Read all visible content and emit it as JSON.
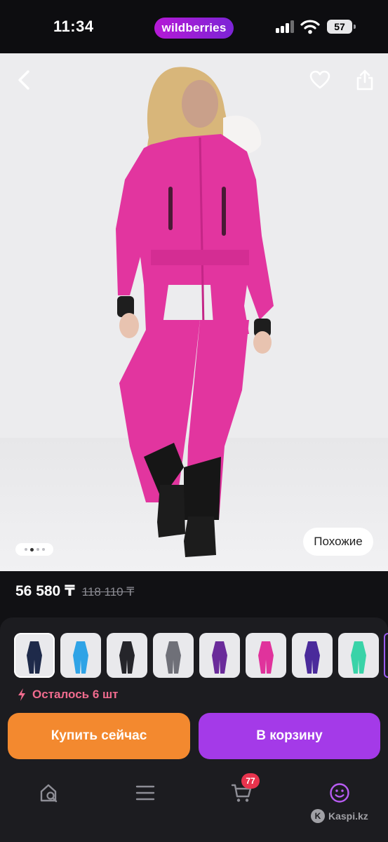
{
  "status_bar": {
    "time": "11:34",
    "brand": "wildberries",
    "battery": "57"
  },
  "photo": {
    "back_icon": "chevron-left-icon",
    "favorite_icon": "heart-icon",
    "share_icon": "share-icon",
    "carousel": {
      "count": 4,
      "active_index": 1
    },
    "similar_label": "Похожие"
  },
  "price": {
    "current": "56 580 ₸",
    "old": "118 110 ₸"
  },
  "variants": [
    {
      "name": "navy",
      "color": "#1e2a4a",
      "selected": true
    },
    {
      "name": "sky-blue",
      "color": "#2fa3e6"
    },
    {
      "name": "black",
      "color": "#25252a"
    },
    {
      "name": "grey",
      "color": "#6f7078"
    },
    {
      "name": "purple",
      "color": "#6a2b9a"
    },
    {
      "name": "pink",
      "color": "#e0339c"
    },
    {
      "name": "violet",
      "color": "#4a2a9b"
    },
    {
      "name": "mint",
      "color": "#39d3a8"
    }
  ],
  "stock": {
    "text": "Осталось 6 шт",
    "color": "#f06b8e"
  },
  "actions": {
    "buy_now": "Купить сейчас",
    "add_to_cart": "В корзину"
  },
  "tabbar": {
    "items": [
      "home-search-icon",
      "menu-icon",
      "cart-icon",
      "profile-icon"
    ],
    "cart_badge": "77",
    "active": "profile-icon"
  },
  "watermark": "Kaspi.kz",
  "colors": {
    "accent": "#a43ae8",
    "buy": "#f3892f",
    "product": "#e2359f"
  }
}
